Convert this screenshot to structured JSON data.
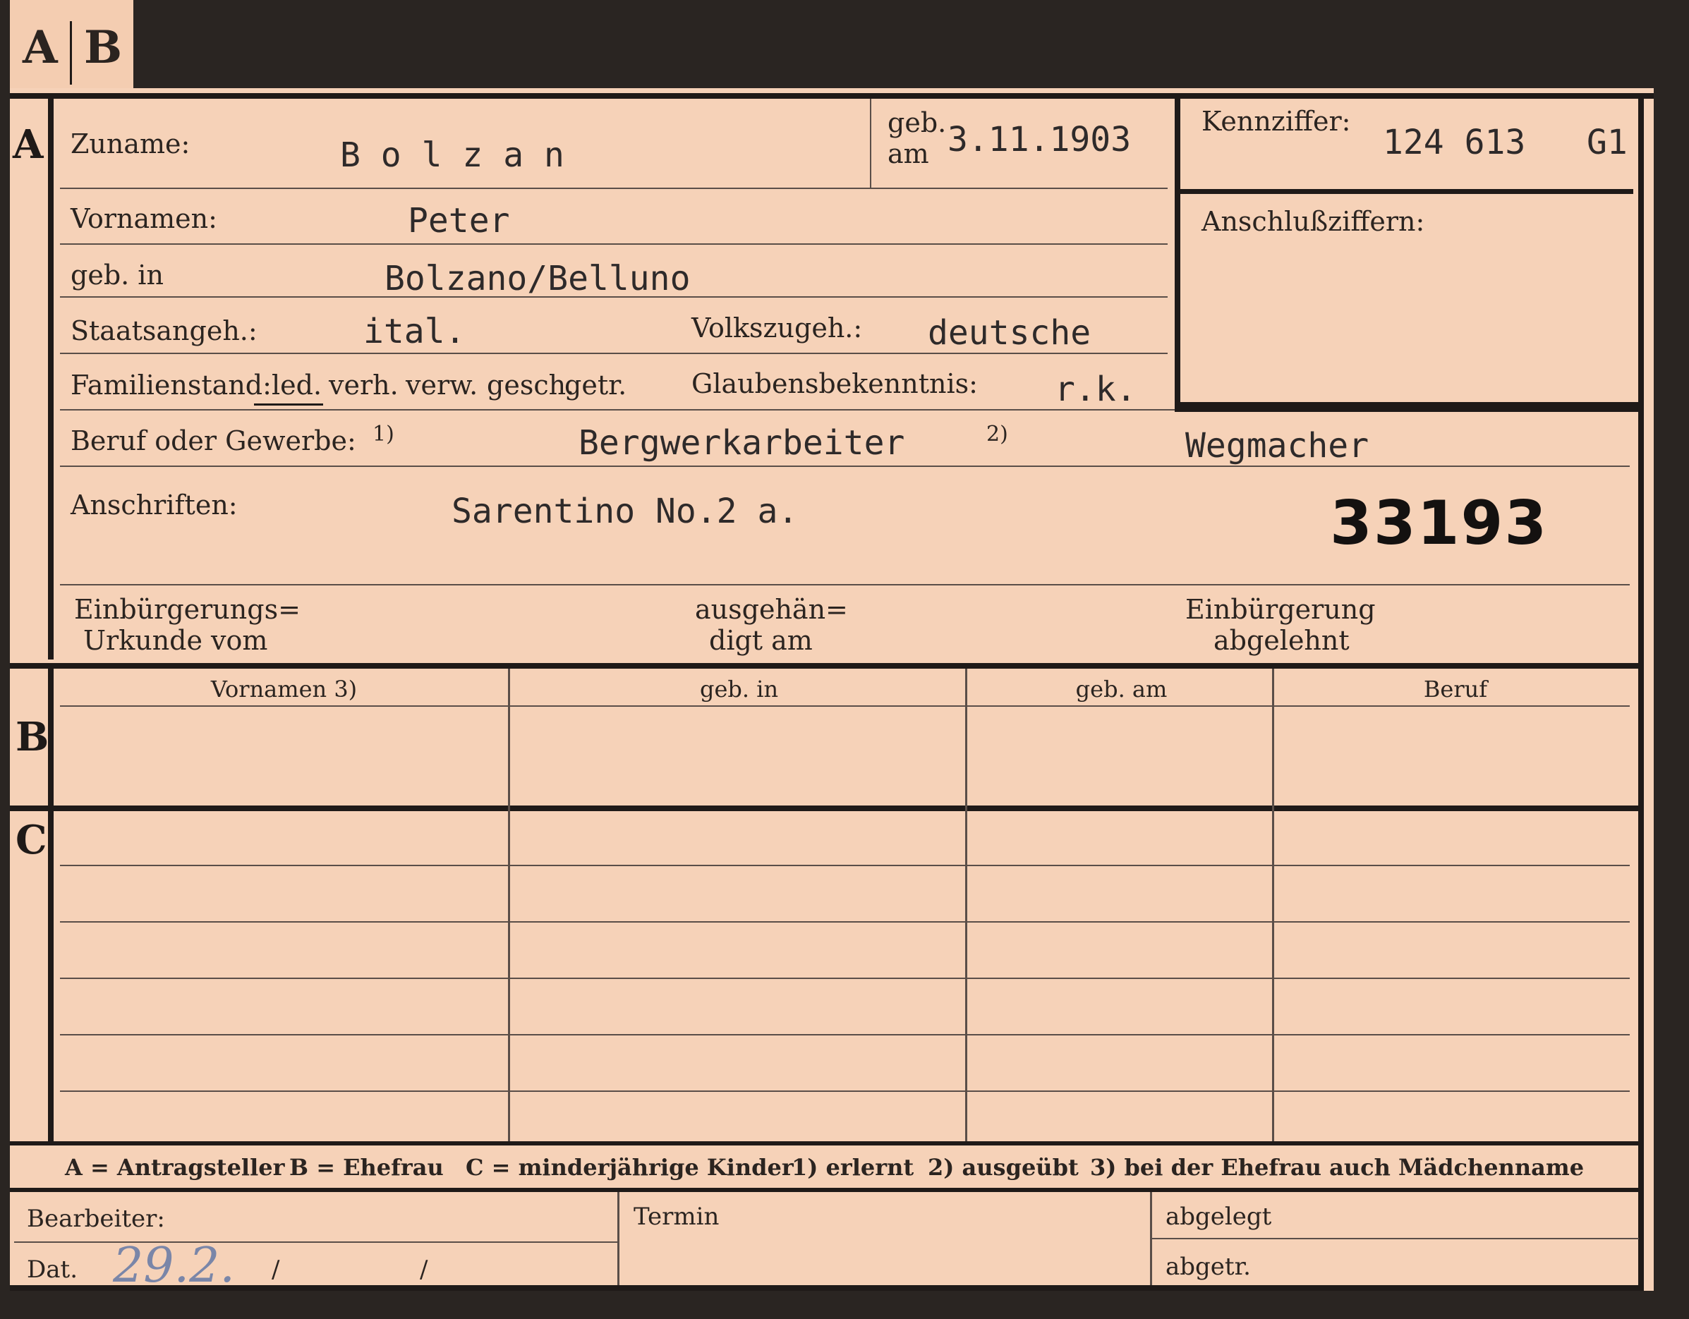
{
  "tabs": {
    "a": "A",
    "b": "B"
  },
  "sections": {
    "a": "A",
    "b": "B",
    "c": "C"
  },
  "surname": {
    "label": "Zuname:",
    "value": "B o l z a n"
  },
  "birthdate": {
    "label_geb": "geb.",
    "label_am": "am",
    "value": "3.11.1903"
  },
  "kennziffer": {
    "label": "Kennziffer:",
    "value": "124 613   G1"
  },
  "anschlussziffern": {
    "label": "Anschlußziffern:"
  },
  "vornamen": {
    "label": "Vornamen:",
    "value": "Peter"
  },
  "birthplace": {
    "label": "geb. in",
    "value": "Bolzano/Belluno"
  },
  "citizenship": {
    "label": "Staatsangeh.:",
    "value": "ital."
  },
  "ethnicity": {
    "label": "Volkszugeh.:",
    "value": "deutsche"
  },
  "family_status": {
    "label": "Familienstand:",
    "options": [
      "led.",
      "verh.",
      "verw.",
      "gesch.",
      "getr."
    ],
    "selected": "led."
  },
  "religion": {
    "label": "Glaubensbekenntnis:",
    "value": "r.k."
  },
  "occupation": {
    "label": "Beruf oder Gewerbe:",
    "mark1": "1)",
    "value1": "Bergwerkarbeiter",
    "mark2": "2)",
    "value2": "Wegmacher"
  },
  "addresses": {
    "label": "Anschriften:",
    "value": "Sarentino No.2 a.",
    "stamp_number": "33193"
  },
  "naturalization": {
    "certificate_line1": "Einbürgerungs=",
    "certificate_line2": "Urkunde vom",
    "handed_line1": "ausgehän=",
    "handed_line2": "digt am",
    "rejected_line1": "Einbürgerung",
    "rejected_line2": "abgelehnt"
  },
  "table_headers": {
    "first_names": "Vornamen 3)",
    "birthplace": "geb. in",
    "birthdate": "geb. am",
    "occupation": "Beruf"
  },
  "legend": {
    "a": "A = Antragsteller",
    "b": "B = Ehefrau",
    "c": "C = minderjährige Kinder",
    "n1": "1) erlernt",
    "n2": "2) ausgeübt",
    "n3": "3) bei der Ehefrau auch Mädchenname"
  },
  "footer": {
    "bearbeiter": "Bearbeiter:",
    "termin": "Termin",
    "abgelegt": "abgelegt",
    "dat_label": "Dat.",
    "dat_value": "29.2.",
    "slash1": "/",
    "slash2": "/",
    "abgetr": "abgetr."
  },
  "colors": {
    "card": "#f6d2b8",
    "background": "#2a2522",
    "ink": "#2b2420",
    "handwriting": "#7a86a8"
  }
}
